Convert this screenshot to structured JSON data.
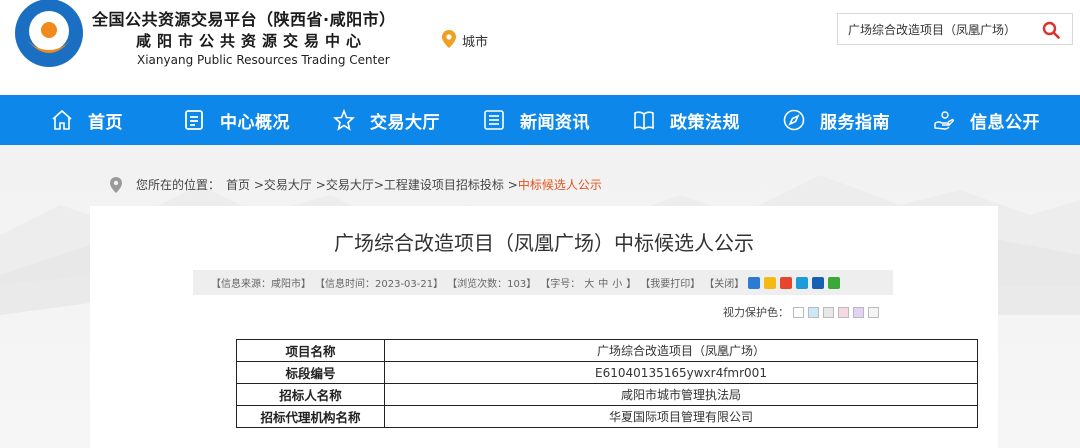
{
  "header": {
    "site_title": "全国公共资源交易平台（陕西省·咸阳市）",
    "site_subtitle": "咸阳市公共资源交易中心",
    "site_title_en": "Xianyang Public Resources Trading Center",
    "location_label": "城市",
    "search_value": "广场综合改造项目（凤凰广场）",
    "colors": {
      "logo_blue": "#1a6fc2",
      "logo_orange": "#f08a1c",
      "location_pin": "#f0a020",
      "search_icon": "#d9342b"
    }
  },
  "nav": {
    "background": "#0e87ea",
    "items": [
      {
        "label": "首页",
        "icon": "home-icon"
      },
      {
        "label": "中心概况",
        "icon": "document-icon"
      },
      {
        "label": "交易大厅",
        "icon": "star-icon"
      },
      {
        "label": "新闻资讯",
        "icon": "list-icon"
      },
      {
        "label": "政策法规",
        "icon": "book-icon"
      },
      {
        "label": "服务指南",
        "icon": "compass-icon"
      },
      {
        "label": "信息公开",
        "icon": "hand-icon"
      }
    ]
  },
  "breadcrumb": {
    "prefix": "您所在的位置：",
    "items": [
      "首页",
      "交易大厅",
      "交易大厅",
      "工程建设项目招标投标"
    ],
    "separator": ">",
    "current": "中标候选人公示",
    "current_color": "#e2541e"
  },
  "article": {
    "title": "广场综合改造项目（凤凰广场）中标候选人公示",
    "meta": {
      "source": "【信息来源：咸阳市】",
      "time": "【信息时间：2023-03-21】",
      "views": "【浏览次数：103】",
      "font_label": "【字号：",
      "font_large": "大",
      "font_medium": "中",
      "font_small": "小",
      "font_end": "】",
      "print": "【我要打印】",
      "close": "【关闭】"
    },
    "share_icons": [
      "share-plus-icon",
      "qzone-icon",
      "weibo-icon",
      "tencent-weibo-icon",
      "renren-icon",
      "wechat-icon"
    ],
    "eye_protect_label": "视力保护色：",
    "eye_colors": [
      "#ffffff",
      "#cce8f7",
      "#e8e8e8",
      "#f6d8e0",
      "#e3d3f2",
      "#f4f4f4"
    ]
  },
  "table": {
    "rows": [
      {
        "key": "项目名称",
        "value": "广场综合改造项目（凤凰广场）"
      },
      {
        "key": "标段编号",
        "value": "E61040135165ywxr4fmr001"
      },
      {
        "key": "招标人名称",
        "value": "咸阳市城市管理执法局"
      },
      {
        "key": "招标代理机构名称",
        "value": "华夏国际项目管理有限公司"
      }
    ]
  }
}
